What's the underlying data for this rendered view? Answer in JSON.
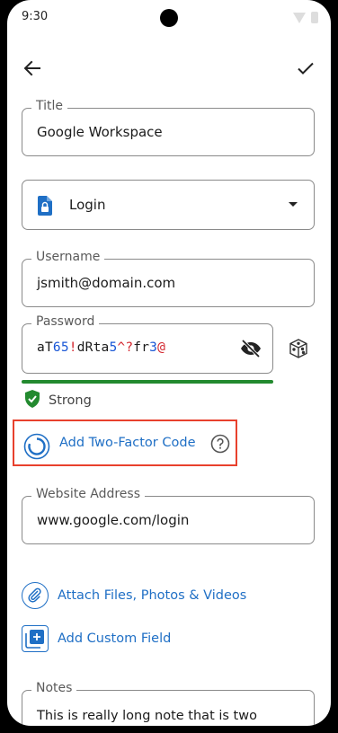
{
  "status_bar": {
    "time": "9:30"
  },
  "header": {
    "back_icon": "arrow-left-icon",
    "save_icon": "check-icon"
  },
  "form": {
    "title": {
      "label": "Title",
      "value": "Google Workspace"
    },
    "type": {
      "value": "Login",
      "icon": "lock-file-icon"
    },
    "username": {
      "label": "Username",
      "value": "jsmith@domain.com"
    },
    "password": {
      "label": "Password",
      "value": "aT65!dRta5^?fr3@"
    },
    "strength": {
      "label": "Strong",
      "level": 1.0,
      "color": "#238a2f"
    },
    "two_factor": {
      "label": "Add Two-Factor Code"
    },
    "website": {
      "label": "Website Address",
      "value": "www.google.com/login"
    },
    "attach": {
      "label": "Attach Files, Photos & Videos"
    },
    "custom_field": {
      "label": "Add Custom Field"
    },
    "notes": {
      "label": "Notes",
      "value": "This is really long note that is two"
    }
  },
  "colors": {
    "accent": "#1f6fc5",
    "highlight": "#e8412d",
    "strong": "#238a2f"
  }
}
